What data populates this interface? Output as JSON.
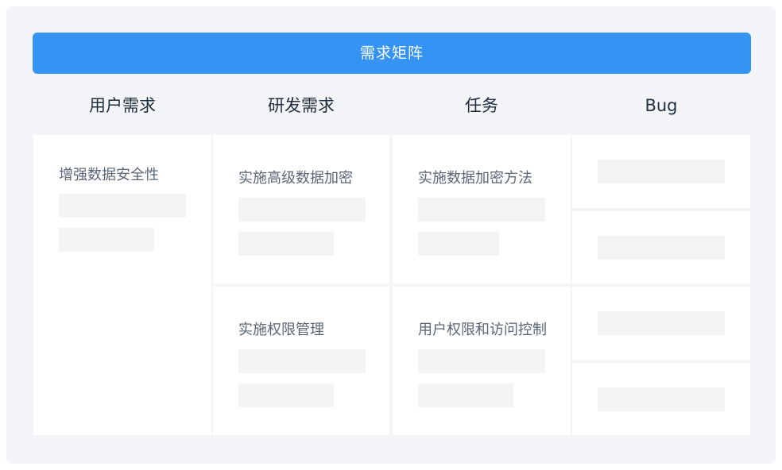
{
  "banner": {
    "title": "需求矩阵"
  },
  "columns": [
    {
      "label": "用户需求"
    },
    {
      "label": "研发需求"
    },
    {
      "label": "任务"
    },
    {
      "label": "Bug"
    }
  ],
  "cards": {
    "user_req": {
      "title": "增强数据安全性"
    },
    "dev_req_1": {
      "title": "实施高级数据加密"
    },
    "dev_req_2": {
      "title": "实施权限管理"
    },
    "task_1": {
      "title": "实施数据加密方法"
    },
    "task_2": {
      "title": "用户权限和访问控制"
    }
  },
  "colors": {
    "accent": "#3593f4",
    "panel_bg": "#f3f5f8",
    "card_bg": "#ffffff",
    "placeholder": "#f3f4f6",
    "heading_text": "#1f2d3d",
    "card_text": "#5b6675"
  }
}
